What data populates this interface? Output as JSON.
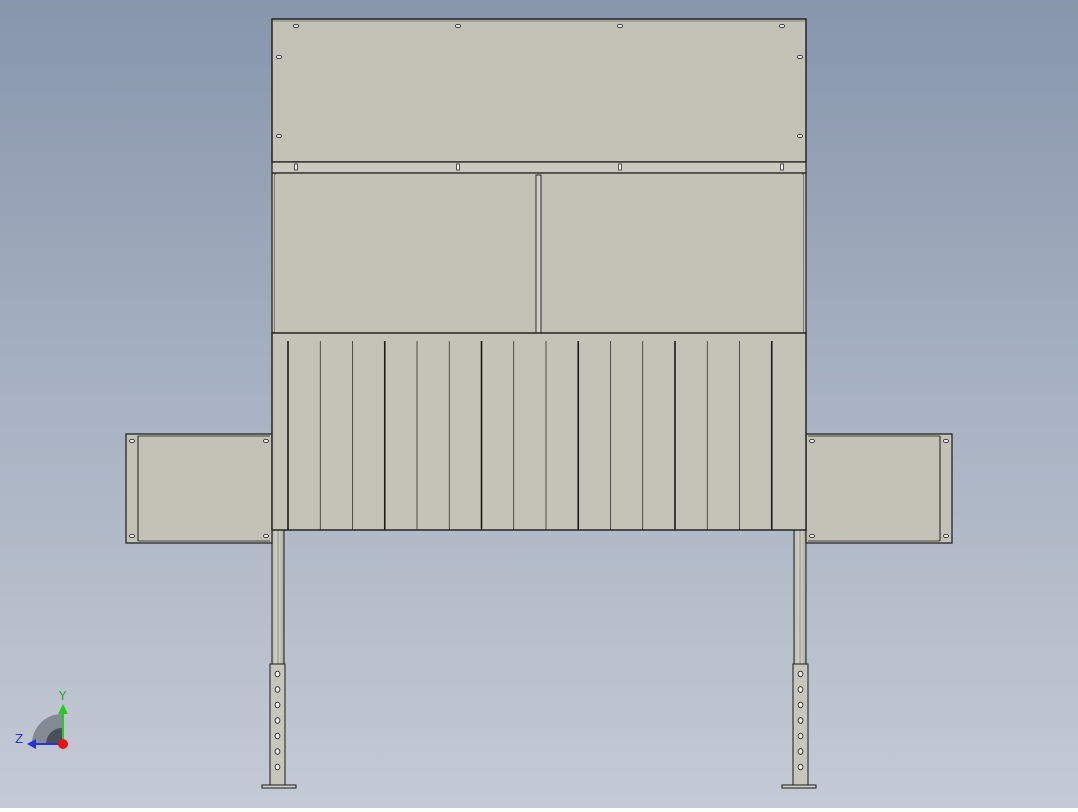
{
  "viewport": {
    "background_top": "#8796ac",
    "background_bottom": "#c4cad5"
  },
  "model": {
    "panel_fill": "#c1c1b6",
    "panel_fill_light": "#c9c9bf",
    "edge_color": "#1a1a1a",
    "louver_count": 16
  },
  "triad": {
    "y_label": "Y",
    "z_label": "Z",
    "y_color": "#22cc22",
    "z_color": "#2233dd",
    "x_color": "#ee1111"
  }
}
